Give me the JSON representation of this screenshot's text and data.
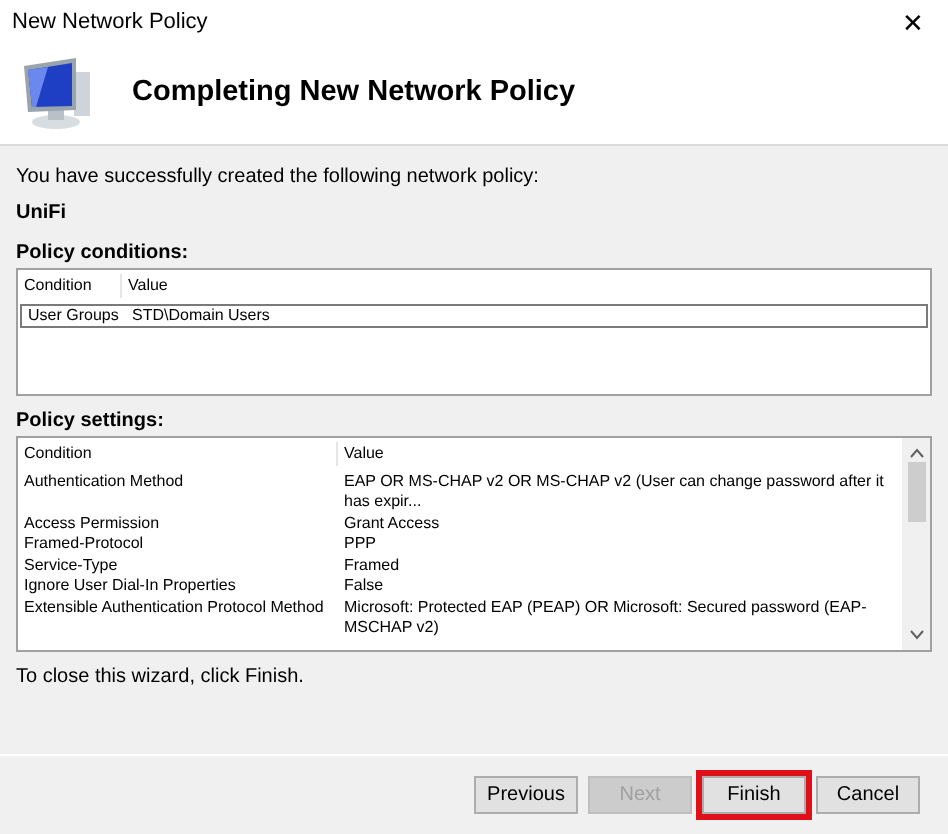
{
  "window": {
    "title": "New Network Policy",
    "close": "✕"
  },
  "header": {
    "title": "Completing New Network Policy"
  },
  "intro": "You have successfully created the following network policy:",
  "policy_name": "UniFi",
  "conditions": {
    "label": "Policy conditions:",
    "columns": [
      "Condition",
      "Value"
    ],
    "rows": [
      {
        "cells": [
          "User Groups",
          "STD\\Domain Users"
        ],
        "selected": true
      }
    ]
  },
  "settings": {
    "label": "Policy settings:",
    "columns": [
      "Condition",
      "Value"
    ],
    "rows": [
      {
        "cells": [
          "Authentication Method",
          "EAP OR MS-CHAP v2 OR MS-CHAP v2 (User can change password after it has expir..."
        ]
      },
      {
        "cells": [
          "Access Permission",
          "Grant Access"
        ]
      },
      {
        "cells": [
          "Framed-Protocol",
          "PPP"
        ]
      },
      {
        "cells": [
          "Service-Type",
          "Framed"
        ]
      },
      {
        "cells": [
          "Ignore User Dial-In Properties",
          "False"
        ]
      },
      {
        "cells": [
          "Extensible Authentication Protocol Method",
          "Microsoft: Protected EAP (PEAP) OR Microsoft: Secured password (EAP-MSCHAP v2)"
        ]
      }
    ]
  },
  "closing": "To close this wizard, click Finish.",
  "buttons": [
    {
      "label": "Previous",
      "disabled": false,
      "highlighted": false
    },
    {
      "label": "Next",
      "disabled": true,
      "highlighted": false
    },
    {
      "label": "Finish",
      "disabled": false,
      "highlighted": true
    },
    {
      "label": "Cancel",
      "disabled": false,
      "highlighted": false
    }
  ]
}
